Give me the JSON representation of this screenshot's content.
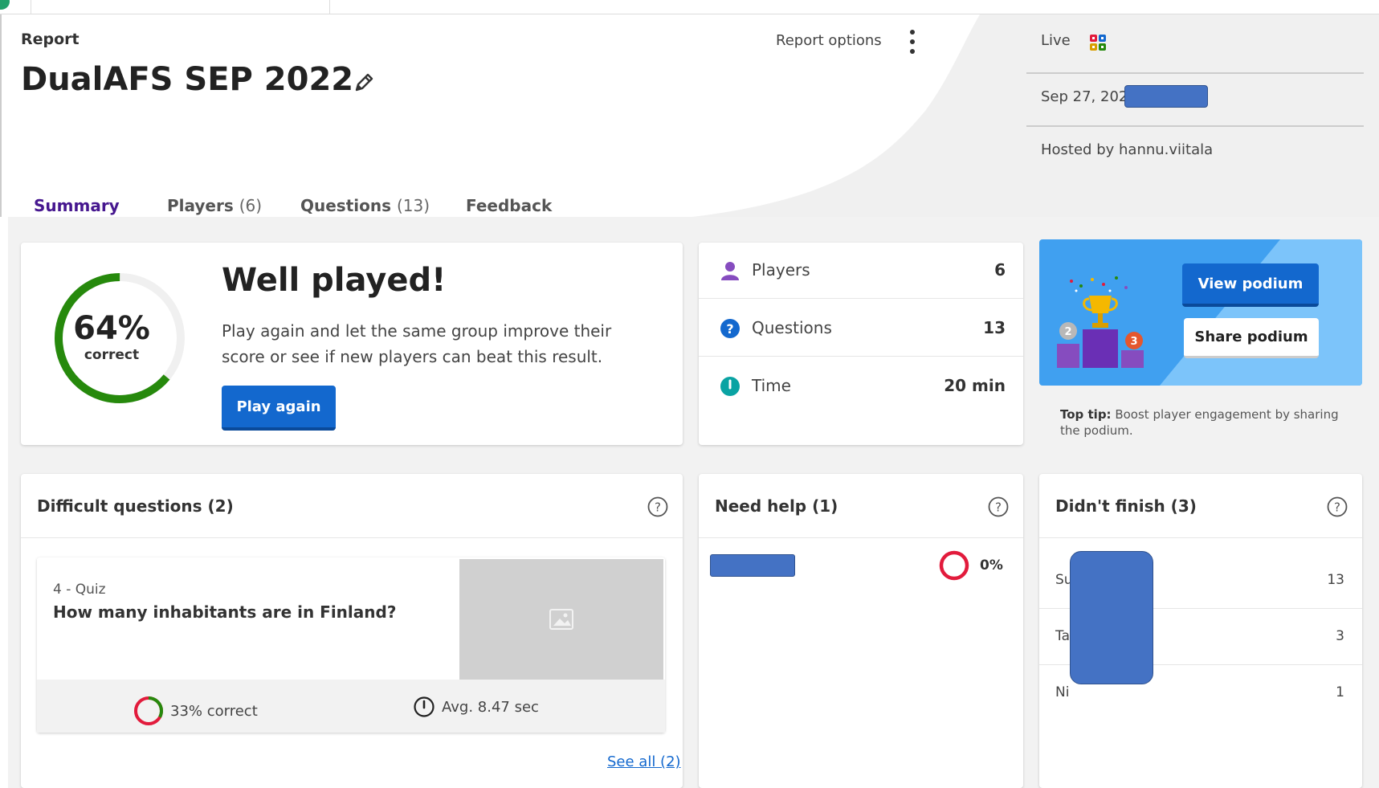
{
  "colors": {
    "accent_purple": "#46178f",
    "primary_blue": "#1368ce",
    "correct_green": "#26890c",
    "wrong_red": "#e21b3c",
    "redaction_blue": "#4472c4"
  },
  "header": {
    "section_label": "Report",
    "title": "DualAFS SEP 2022",
    "report_options_label": "Report options",
    "live_label": "Live",
    "date_text": "Sep 27, 202",
    "hosted_by": "Hosted by hannu.viitala"
  },
  "tabs": [
    {
      "label": "Summary",
      "count": ""
    },
    {
      "label": "Players",
      "count": "(6)"
    },
    {
      "label": "Questions",
      "count": "(13)"
    },
    {
      "label": "Feedback",
      "count": ""
    }
  ],
  "summary": {
    "percent_correct": "64%",
    "percent_value": 0.64,
    "correct_label": "correct",
    "heading": "Well played!",
    "message": "Play again and let the same group improve their score or see if new players can beat this result.",
    "play_again_label": "Play again"
  },
  "stats": [
    {
      "label": "Players",
      "value": "6",
      "icon": "person-icon"
    },
    {
      "label": "Questions",
      "value": "13",
      "icon": "question-icon"
    },
    {
      "label": "Time",
      "value": "20 min",
      "icon": "clock-icon"
    }
  ],
  "podium": {
    "view_label": "View podium",
    "share_label": "Share podium",
    "tip_bold": "Top tip:",
    "tip_text": "Boost player engagement by sharing the podium.",
    "medal_2": "2",
    "medal_3": "3"
  },
  "difficult_questions": {
    "title": "Difficult questions (2)",
    "question_number": "4 - Quiz",
    "question_text": "How many inhabitants are in Finland?",
    "correct_text": "33% correct",
    "correct_value": 0.33,
    "avg_time": "Avg. 8.47 sec",
    "see_all": "See all (2)"
  },
  "need_help": {
    "title": "Need help (1)",
    "percent": "0%"
  },
  "didnt_finish": {
    "title": "Didn't finish (3)",
    "rows": [
      {
        "prefix": "Su",
        "value": "13"
      },
      {
        "prefix": "Ta",
        "value": "3"
      },
      {
        "prefix": "Ni",
        "value": "1"
      }
    ]
  }
}
